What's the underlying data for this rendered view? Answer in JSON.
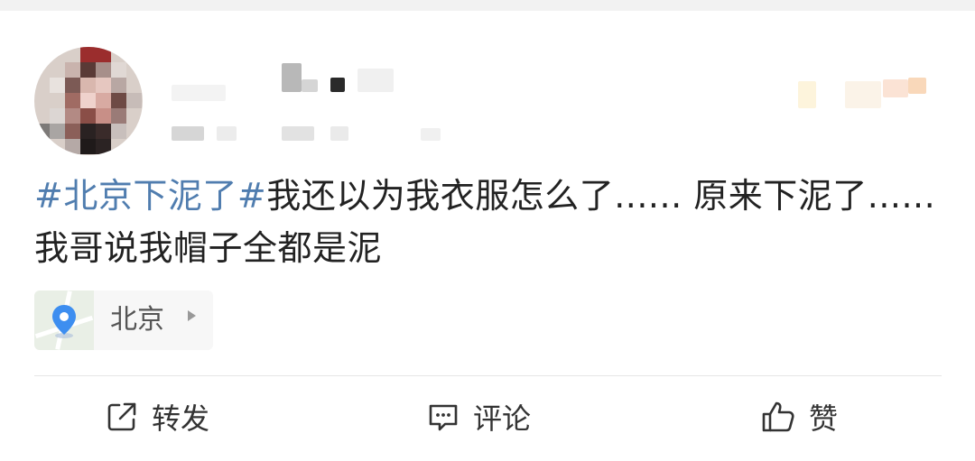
{
  "post": {
    "topic": "#北京下泥了#",
    "body": "我还以为我衣服怎么了...... 原来下泥了...... 我哥说我帽子全都是泥"
  },
  "location": {
    "label": "北京",
    "icon": "location-pin-icon"
  },
  "actions": {
    "repost": {
      "label": "转发",
      "icon": "share-icon"
    },
    "comment": {
      "label": "评论",
      "icon": "comment-icon"
    },
    "like": {
      "label": "赞",
      "icon": "thumbs-up-icon"
    }
  },
  "colors": {
    "topic": "#507daf",
    "text": "#222222",
    "pin": "#3d8ef0"
  }
}
